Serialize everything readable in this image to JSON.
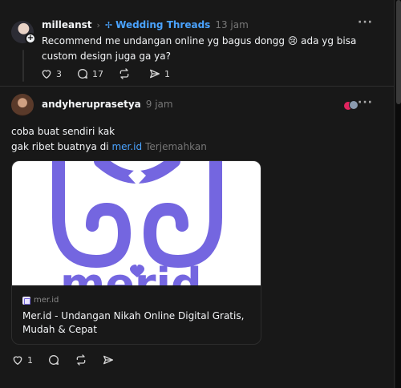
{
  "post1": {
    "username": "milleanst",
    "community": "Wedding Threads",
    "time": "13 jam",
    "text": "Recommend me undangan online yg bagus dongg 😢 ada yg bisa custom design juga ga ya?",
    "likes": "3",
    "replies": "17",
    "reposts": "",
    "shares": "1"
  },
  "post2": {
    "username": "andyheruprasetya",
    "time": "9 jam",
    "line1": "coba buat sendiri kak",
    "line2_prefix": "gak ribet buatnya di ",
    "link": "mer.id",
    "translate": "Terjemahkan",
    "card": {
      "domain": "mer.id",
      "title": "Mer.id - Undangan Nikah Online Digital Gratis, Mudah & Cepat",
      "logo_text": "merid"
    },
    "likes": "1"
  },
  "colors": {
    "background": "#181818",
    "accent": "#4aa3ff",
    "logo": "#7466e0"
  }
}
